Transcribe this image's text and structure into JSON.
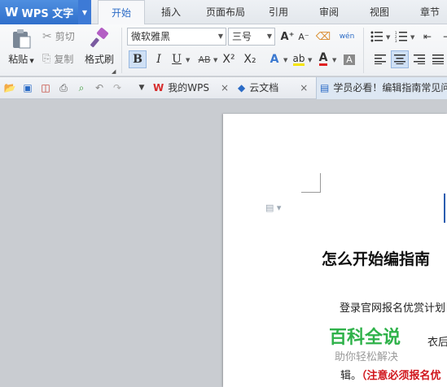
{
  "app": {
    "logo": "W",
    "name": "WPS 文字"
  },
  "menu": {
    "tabs": [
      {
        "label": "开始",
        "active": true
      },
      {
        "label": "插入"
      },
      {
        "label": "页面布局"
      },
      {
        "label": "引用"
      },
      {
        "label": "审阅"
      },
      {
        "label": "视图"
      },
      {
        "label": "章节"
      }
    ]
  },
  "ribbon": {
    "paste_label": "粘贴",
    "cut_label": "剪切",
    "copy_label": "复制",
    "format_painter_label": "格式刷",
    "font_name": "微软雅黑",
    "font_size": "三号",
    "bold": "B",
    "italic": "I",
    "underline": "U",
    "strike": "AB",
    "superscript": "X²",
    "subscript": "X₂",
    "grow_font": "A⁺",
    "shrink_font": "A⁻",
    "pinyin": "wén",
    "font_color_letter": "A",
    "highlight_letter": "ab",
    "accent_color": "#2b6bc6",
    "font_color": "#e02020",
    "highlight_color": "#f5e400"
  },
  "quickbar": {
    "tabs": [
      {
        "label": "我的WPS",
        "close": "×"
      },
      {
        "label": "云文档",
        "close": "×"
      },
      {
        "label": "学员必看！编辑指南常见问"
      }
    ]
  },
  "document": {
    "heading": "怎么开始编指南",
    "line1": "登录官网报名优赏计划",
    "line2": "衣后，",
    "line3_prefix": "辑。",
    "line3_red": "（注意必须报名优",
    "watermark_title": "百科全说",
    "watermark_sub": "助你轻松解决"
  }
}
